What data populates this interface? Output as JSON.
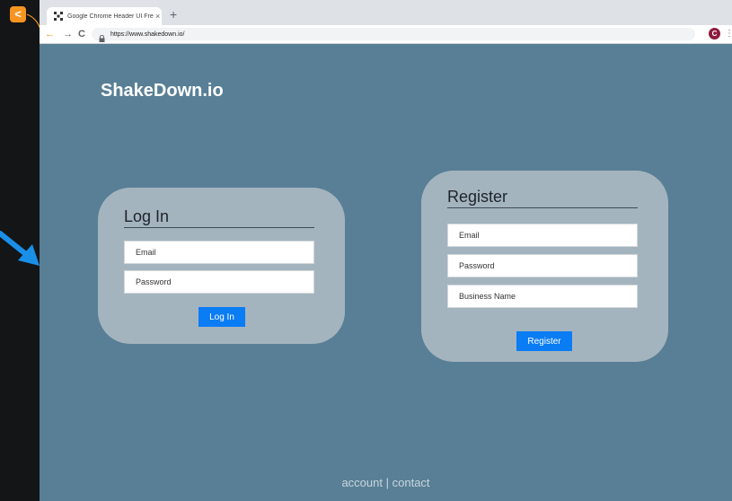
{
  "browser": {
    "tab_title": "Google Chrome Header UI Freebie",
    "tab_close": "×",
    "new_tab": "+",
    "url": "https://www.shakedown.io/",
    "profile_initial": "C",
    "back_icon": "←",
    "forward_icon": "→",
    "reload_icon": "C",
    "menu_icon": "⋮"
  },
  "overlay": {
    "back_badge": "<",
    "accent_color": "#f79420",
    "pointer_color": "#1a8fe8"
  },
  "page": {
    "brand": "ShakeDown.io",
    "background_color": "#587f95",
    "login": {
      "title": "Log In",
      "email_placeholder": "Email",
      "password_placeholder": "Password",
      "submit_label": "Log In"
    },
    "register": {
      "title": "Register",
      "email_placeholder": "Email",
      "password_placeholder": "Password",
      "business_placeholder": "Business Name",
      "submit_label": "Register"
    },
    "footer": {
      "account_link": "account",
      "separator": "|",
      "contact_link": "contact"
    }
  }
}
